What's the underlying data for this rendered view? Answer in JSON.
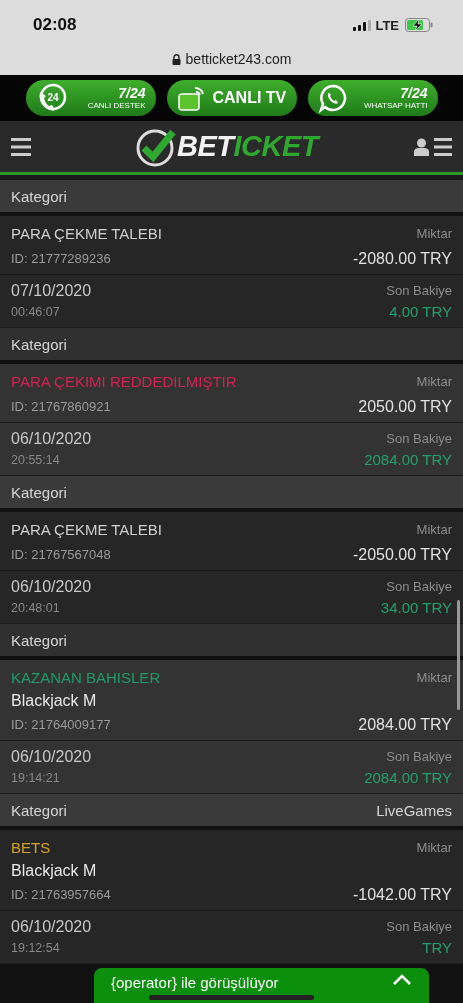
{
  "status_bar": {
    "time": "02:08",
    "network": "LTE"
  },
  "address_bar": {
    "url": "betticket243.com"
  },
  "promo_buttons": [
    {
      "kind": "phone",
      "icon_text": "24",
      "title": "7/24",
      "subtitle": "CANLI DESTEK"
    },
    {
      "kind": "tv",
      "title": "CANLI TV"
    },
    {
      "kind": "whatsapp",
      "title": "7/24",
      "subtitle": "WHATSAP HATTI"
    }
  ],
  "logo": {
    "part_1": "BET",
    "part_2": "ICKET"
  },
  "top_category": {
    "label": "Kategori"
  },
  "transactions": [
    {
      "type": "PARA ÇEKME TALEBI",
      "color": "#cfcfcf",
      "id": "ID: 21777289236",
      "amount_label": "Miktar",
      "amount": "-2080.00 TRY",
      "date": "07/10/2020",
      "time": "00:46:07",
      "balance_label": "Son Bakiye",
      "balance": "4.00 TRY",
      "category_label": "Kategori"
    },
    {
      "type": "PARA ÇEKIMI REDDEDILMIŞTIR",
      "color": "#d61f55",
      "id": "ID: 21767860921",
      "amount_label": "Miktar",
      "amount": "2050.00 TRY",
      "date": "06/10/2020",
      "time": "20:55:14",
      "balance_label": "Son Bakiye",
      "balance": "2084.00 TRY",
      "category_label": "Kategori"
    },
    {
      "type": "PARA ÇEKME TALEBI",
      "color": "#cfcfcf",
      "id": "ID: 21767567048",
      "amount_label": "Miktar",
      "amount": "-2050.00 TRY",
      "date": "06/10/2020",
      "time": "20:48:01",
      "balance_label": "Son Bakiye",
      "balance": "34.00 TRY",
      "category_label": "Kategori"
    },
    {
      "type": "KAZANAN BAHISLER",
      "color": "#1f9a6c",
      "game": "Blackjack M",
      "id": "ID: 21764009177",
      "amount_label": "Miktar",
      "amount": "2084.00 TRY",
      "date": "06/10/2020",
      "time": "19:14:21",
      "balance_label": "Son Bakiye",
      "balance": "2084.00 TRY",
      "category_label": "Kategori",
      "category_value": "LiveGames"
    },
    {
      "type": "BETS",
      "color": "#d4a42a",
      "game": "Blackjack M",
      "id": "ID: 21763957664",
      "amount_label": "Miktar",
      "amount": "-1042.00 TRY",
      "date": "06/10/2020",
      "time": "19:12:54",
      "balance_label": "Son Bakiye",
      "balance": "TRY"
    }
  ],
  "chat_bar": {
    "text": "{operator} ile görüşülüyor"
  }
}
